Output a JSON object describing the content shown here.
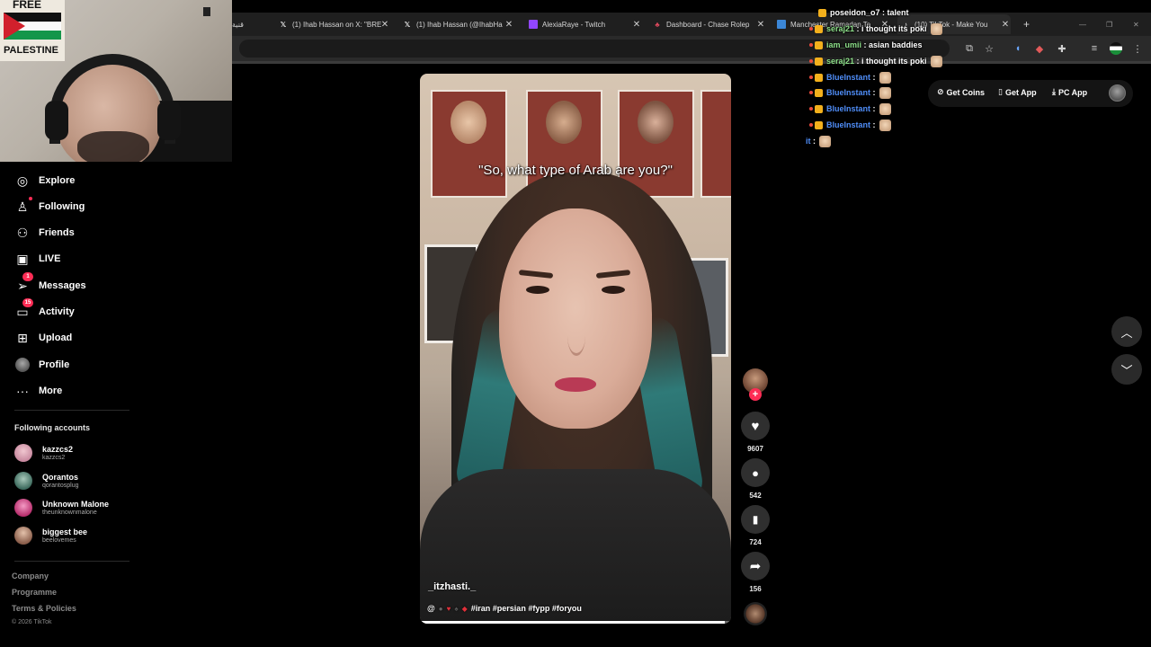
{
  "browser": {
    "tabs": [
      {
        "title": "قنية",
        "icon": "arabic-site-icon",
        "left": 0
      },
      {
        "title": "(1) Ihab Hassan on X: \"BRE",
        "icon": "x-logo-icon"
      },
      {
        "title": "(1) Ihab Hassan (@IhabHa",
        "icon": "x-logo-icon"
      },
      {
        "title": "AlexiaRaye - Twitch",
        "icon": "twitch-icon"
      },
      {
        "title": "Dashboard - Chase Rolep",
        "icon": "chase-icon"
      },
      {
        "title": "Manchester Ramadan Te",
        "icon": "calendar-icon"
      },
      {
        "title": "(10) TikTok - Make You",
        "icon": "tiktok-icon"
      }
    ],
    "new_tab": "+",
    "minimize": "—",
    "maximize": "❐",
    "close": "✕"
  },
  "sidebar": {
    "nav": [
      {
        "label": "Explore",
        "icon": "compass-icon",
        "glyph": "◎"
      },
      {
        "label": "Following",
        "icon": "following-icon",
        "glyph": "♙"
      },
      {
        "label": "Friends",
        "icon": "friends-icon",
        "glyph": "⚇"
      },
      {
        "label": "LIVE",
        "icon": "live-icon",
        "glyph": "▣"
      },
      {
        "label": "Messages",
        "icon": "messages-icon",
        "glyph": "➢",
        "badge": "1"
      },
      {
        "label": "Activity",
        "icon": "activity-icon",
        "glyph": "▭",
        "badge": "15"
      },
      {
        "label": "Upload",
        "icon": "upload-icon",
        "glyph": "⊞"
      },
      {
        "label": "Profile",
        "icon": "profile-icon",
        "glyph": "●"
      },
      {
        "label": "More",
        "icon": "more-icon",
        "glyph": "···"
      }
    ],
    "following_title": "Following accounts",
    "accounts": [
      {
        "name": "kazzcs2",
        "handle": "kazzcs2",
        "color": "#c98aa0"
      },
      {
        "name": "Qorantos",
        "handle": "qorantosplug",
        "color": "#5f8a7a"
      },
      {
        "name": "Unknown Malone",
        "handle": "theunknownmalone",
        "color": "#d04a86"
      },
      {
        "name": "biggest bee",
        "handle": "beelovemes",
        "color": "#b0887a"
      }
    ],
    "footer": [
      "Company",
      "Programme",
      "Terms & Policies"
    ],
    "copyright": "© 2026 TikTok"
  },
  "webcam": {
    "poster_lines": [
      "FREE",
      "PALESTINE"
    ]
  },
  "video": {
    "caption": "\"So, what type of Arab are you?\"",
    "author": "_itzhasti._",
    "description_prefix": "@",
    "hashtags": "#iran #persian #fypp #foryou",
    "progress": 0.98
  },
  "actions": {
    "follow": "+",
    "likes": "9607",
    "comments": "542",
    "saves": "724",
    "shares": "156"
  },
  "top_buttons": {
    "coins": "Get Coins",
    "app": "Get App",
    "pc_app": "PC App"
  },
  "chat": [
    {
      "user": "poseidon_o7",
      "color": "#ffffff",
      "text": "talent"
    },
    {
      "user": "seraj21",
      "color": "#8ee08a",
      "text": "i thought its poki",
      "emote": true
    },
    {
      "user": "iam_umii",
      "color": "#8ee08a",
      "text": "asian baddies"
    },
    {
      "user": "seraj21",
      "color": "#8ee08a",
      "text": "i thought its poki",
      "emote": true
    },
    {
      "user": "BlueInstant",
      "color": "#4f8df7",
      "text": "",
      "emote": true
    },
    {
      "user": "BlueInstant",
      "color": "#4f8df7",
      "text": "",
      "emote": true
    },
    {
      "user": "BlueInstant",
      "color": "#4f8df7",
      "text": "",
      "emote": true
    },
    {
      "user": "BlueInstant",
      "color": "#4f8df7",
      "text": "",
      "emote": true
    },
    {
      "user": "it",
      "color": "#4f8df7",
      "text": "",
      "emote": true,
      "partial": true
    }
  ]
}
